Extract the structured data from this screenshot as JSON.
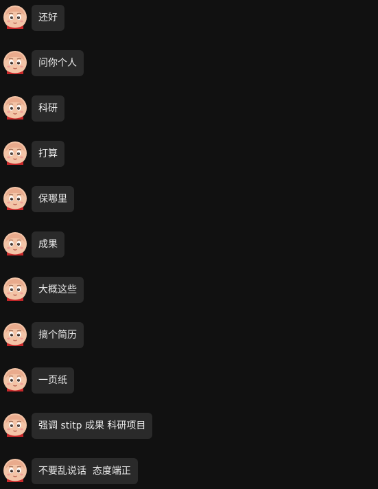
{
  "messages": [
    {
      "text": "还好"
    },
    {
      "text": "问你个人"
    },
    {
      "text": "科研"
    },
    {
      "text": "打算"
    },
    {
      "text": "保哪里"
    },
    {
      "text": "成果"
    },
    {
      "text": "大概这些"
    },
    {
      "text": "搞个简历"
    },
    {
      "text": "一页纸"
    },
    {
      "text": "强调 stitp 成果 科研项目"
    },
    {
      "text": "不要乱说话  态度端正"
    }
  ],
  "colors": {
    "background": "#111111",
    "bubble": "#2a2a2a",
    "text": "#eaeaea"
  },
  "icons": {
    "avatar": "cartoon-boy-face-icon"
  }
}
